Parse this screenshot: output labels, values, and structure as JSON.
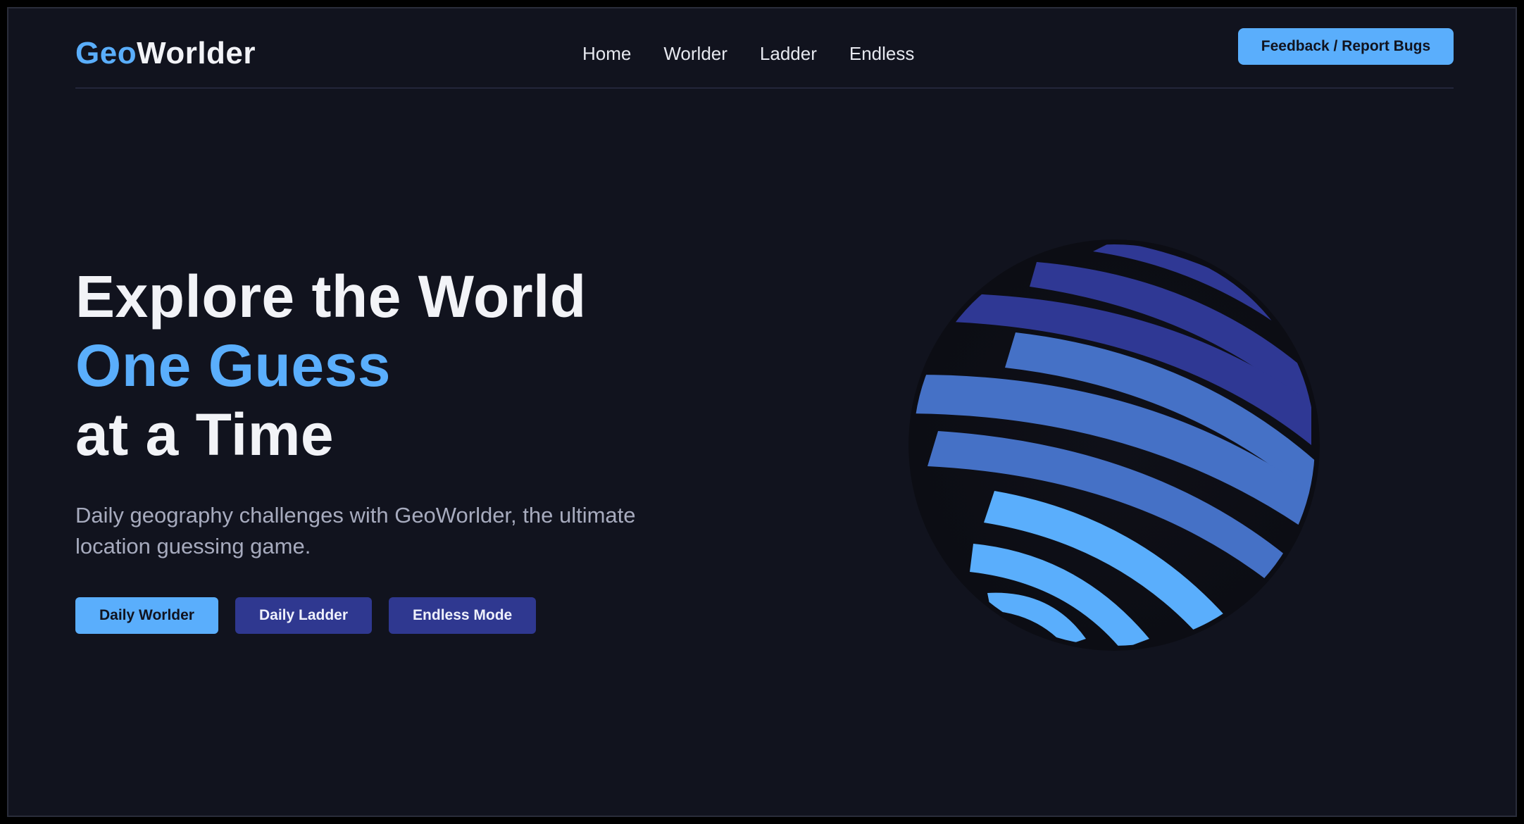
{
  "brand": {
    "logo_part1": "Geo",
    "logo_part2": "Worlder",
    "accent_color": "#5aaefc",
    "secondary_color": "#2f3890",
    "background_color": "#11131e"
  },
  "nav": {
    "items": [
      {
        "label": "Home"
      },
      {
        "label": "Worlder"
      },
      {
        "label": "Ladder"
      },
      {
        "label": "Endless"
      }
    ],
    "feedback_label": "Feedback / Report Bugs"
  },
  "hero": {
    "headline_line1": "Explore the World",
    "headline_line2": "One Guess",
    "headline_line3": "at a Time",
    "subtitle": "Daily geography challenges with GeoWorlder, the ultimate location guessing game.",
    "buttons": {
      "daily_worlder": "Daily Worlder",
      "daily_ladder": "Daily Ladder",
      "endless_mode": "Endless Mode"
    }
  },
  "illustration": {
    "icon": "striped-globe-icon",
    "stripe_colors": [
      "#2f3894",
      "#4571c6",
      "#5aaefc"
    ]
  }
}
